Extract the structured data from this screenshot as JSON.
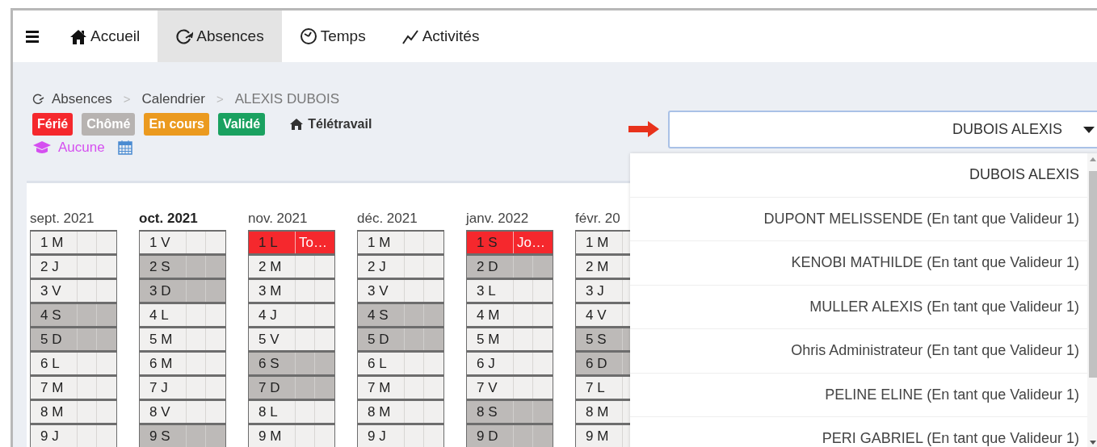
{
  "nav": {
    "items": [
      {
        "label": "Accueil",
        "selected": false
      },
      {
        "label": "Absences",
        "selected": true
      },
      {
        "label": "Temps",
        "selected": false
      },
      {
        "label": "Activités",
        "selected": false
      }
    ]
  },
  "breadcrumb": {
    "separator": ">",
    "items": [
      "Absences",
      "Calendrier",
      "ALEXIS DUBOIS"
    ]
  },
  "legend": [
    {
      "label": "Férié",
      "kind": "badge",
      "color": "#f5282d"
    },
    {
      "label": "Chômé",
      "kind": "badge",
      "color": "#b7b3b1"
    },
    {
      "label": "En cours",
      "kind": "badge",
      "color": "#eb9a1f"
    },
    {
      "label": "Validé",
      "kind": "badge",
      "color": "#1aa160"
    },
    {
      "label": "Télétravail",
      "kind": "home"
    }
  ],
  "training": {
    "label": "Aucune"
  },
  "employee_select": {
    "value": "DUBOIS ALEXIS",
    "expanded": true,
    "options": [
      {
        "label": "DUBOIS ALEXIS",
        "selected": true
      },
      {
        "label": "DUPONT MELISSENDE (En tant que Valideur 1)",
        "selected": false
      },
      {
        "label": "KENOBI MATHILDE (En tant que Valideur 1)",
        "selected": false
      },
      {
        "label": "MULLER ALEXIS (En tant que Valideur 1)",
        "selected": false
      },
      {
        "label": "Ohris Administrateur (En tant que Valideur 1)",
        "selected": false
      },
      {
        "label": "PELINE ELINE (En tant que Valideur 1)",
        "selected": false
      },
      {
        "label": "PERI GABRIEL (En tant que Valideur 1)",
        "selected": false
      }
    ]
  },
  "months": [
    {
      "label": "sept. 2021",
      "current": false,
      "days": [
        {
          "label": "1 M",
          "kind": "workday"
        },
        {
          "label": "2 J",
          "kind": "workday"
        },
        {
          "label": "3 V",
          "kind": "workday"
        },
        {
          "label": "4 S",
          "kind": "weekend"
        },
        {
          "label": "5 D",
          "kind": "weekend"
        },
        {
          "label": "6 L",
          "kind": "workday"
        },
        {
          "label": "7 M",
          "kind": "workday"
        },
        {
          "label": "8 M",
          "kind": "workday"
        },
        {
          "label": "9 J",
          "kind": "workday"
        }
      ]
    },
    {
      "label": "oct. 2021",
      "current": true,
      "days": [
        {
          "label": "1 V",
          "kind": "workday"
        },
        {
          "label": "2 S",
          "kind": "weekend"
        },
        {
          "label": "3 D",
          "kind": "weekend"
        },
        {
          "label": "4 L",
          "kind": "workday"
        },
        {
          "label": "5 M",
          "kind": "workday"
        },
        {
          "label": "6 M",
          "kind": "workday"
        },
        {
          "label": "7 J",
          "kind": "workday"
        },
        {
          "label": "8 V",
          "kind": "workday"
        },
        {
          "label": "9 S",
          "kind": "weekend"
        }
      ]
    },
    {
      "label": "nov. 2021",
      "current": false,
      "days": [
        {
          "label": "1 L",
          "kind": "holiday",
          "note": "To…"
        },
        {
          "label": "2 M",
          "kind": "workday"
        },
        {
          "label": "3 M",
          "kind": "workday"
        },
        {
          "label": "4 J",
          "kind": "workday"
        },
        {
          "label": "5 V",
          "kind": "workday"
        },
        {
          "label": "6 S",
          "kind": "weekend"
        },
        {
          "label": "7 D",
          "kind": "weekend"
        },
        {
          "label": "8 L",
          "kind": "workday"
        },
        {
          "label": "9 M",
          "kind": "workday"
        }
      ]
    },
    {
      "label": "déc. 2021",
      "current": false,
      "days": [
        {
          "label": "1 M",
          "kind": "workday"
        },
        {
          "label": "2 J",
          "kind": "workday"
        },
        {
          "label": "3 V",
          "kind": "workday"
        },
        {
          "label": "4 S",
          "kind": "weekend"
        },
        {
          "label": "5 D",
          "kind": "weekend"
        },
        {
          "label": "6 L",
          "kind": "workday"
        },
        {
          "label": "7 M",
          "kind": "workday"
        },
        {
          "label": "8 M",
          "kind": "workday"
        },
        {
          "label": "9 J",
          "kind": "workday"
        }
      ]
    },
    {
      "label": "janv. 2022",
      "current": false,
      "days": [
        {
          "label": "1 S",
          "kind": "holiday",
          "note": "Jo…"
        },
        {
          "label": "2 D",
          "kind": "weekend"
        },
        {
          "label": "3 L",
          "kind": "workday"
        },
        {
          "label": "4 M",
          "kind": "workday"
        },
        {
          "label": "5 M",
          "kind": "workday"
        },
        {
          "label": "6 J",
          "kind": "workday"
        },
        {
          "label": "7 V",
          "kind": "workday"
        },
        {
          "label": "8 S",
          "kind": "weekend"
        },
        {
          "label": "9 D",
          "kind": "weekend"
        }
      ]
    },
    {
      "label": "févr. 20",
      "current": false,
      "days": [
        {
          "label": "1 M",
          "kind": "workday"
        },
        {
          "label": "2 M",
          "kind": "workday"
        },
        {
          "label": "3 J",
          "kind": "workday"
        },
        {
          "label": "4 V",
          "kind": "workday"
        },
        {
          "label": "5 S",
          "kind": "weekend"
        },
        {
          "label": "6 D",
          "kind": "weekend"
        },
        {
          "label": "7 L",
          "kind": "workday"
        },
        {
          "label": "8 M",
          "kind": "workday"
        },
        {
          "label": "9 M",
          "kind": "workday"
        }
      ]
    }
  ]
}
